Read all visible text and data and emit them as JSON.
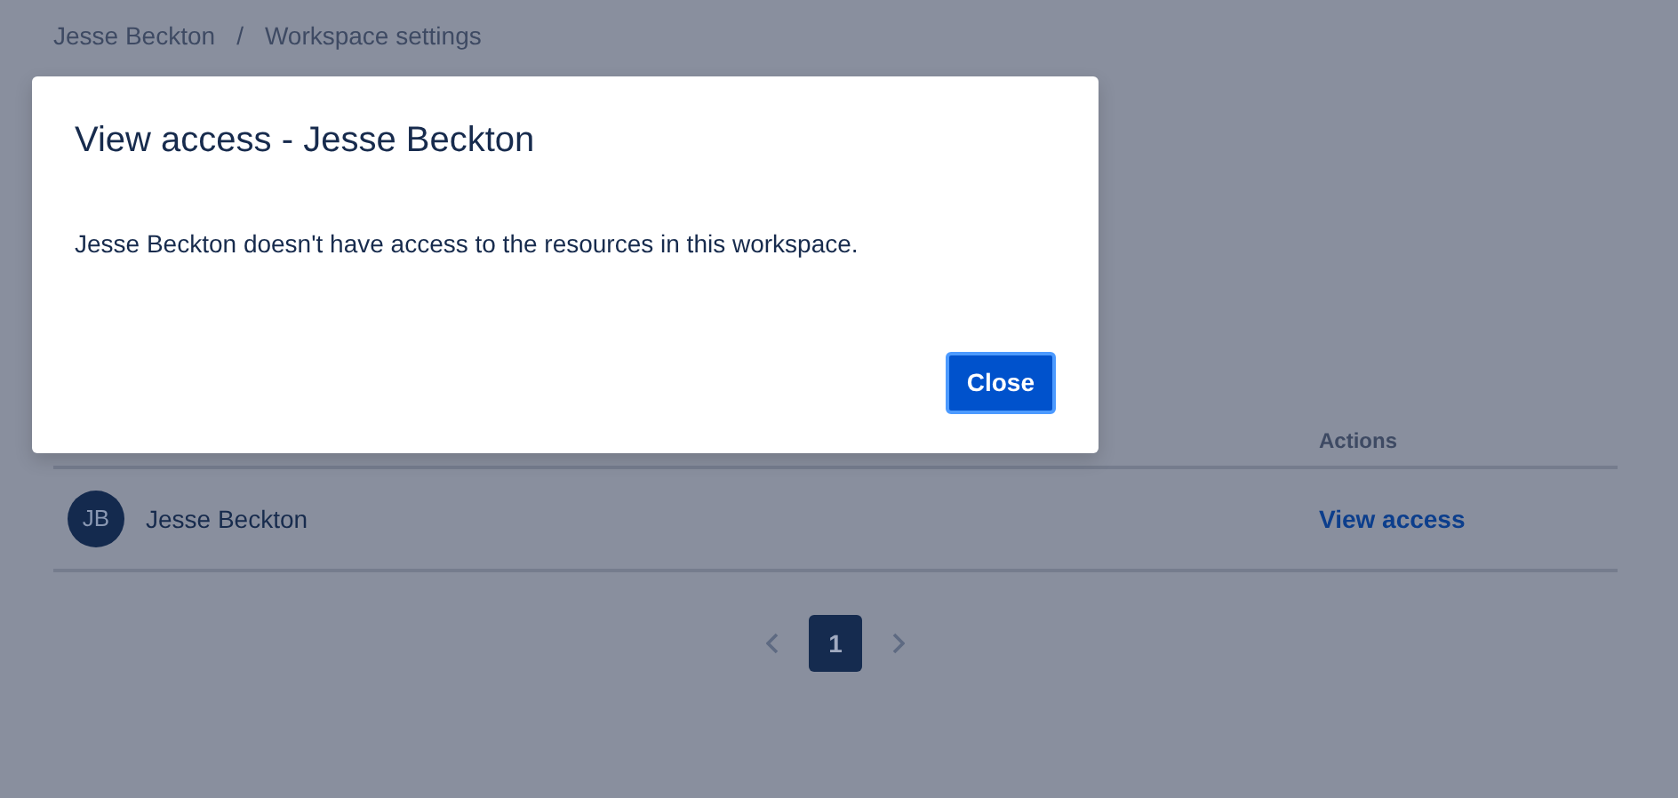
{
  "breadcrumbs": [
    {
      "label": "Jesse Beckton"
    },
    {
      "label": "Workspace settings"
    }
  ],
  "breadcrumb_separator": "/",
  "table": {
    "columns": [
      {},
      {
        "label": "Actions"
      }
    ],
    "rows": [
      {
        "initials": "JB",
        "name": "Jesse Beckton",
        "action": "View access"
      }
    ]
  },
  "pagination": {
    "pages": [
      {
        "label": "1",
        "selected": true
      }
    ]
  },
  "dialog": {
    "title": "View access - Jesse Beckton",
    "message": "Jesse Beckton doesn't have access to the resources in this workspace.",
    "buttons": [
      {
        "label": "Close",
        "kind": "primary"
      }
    ]
  }
}
